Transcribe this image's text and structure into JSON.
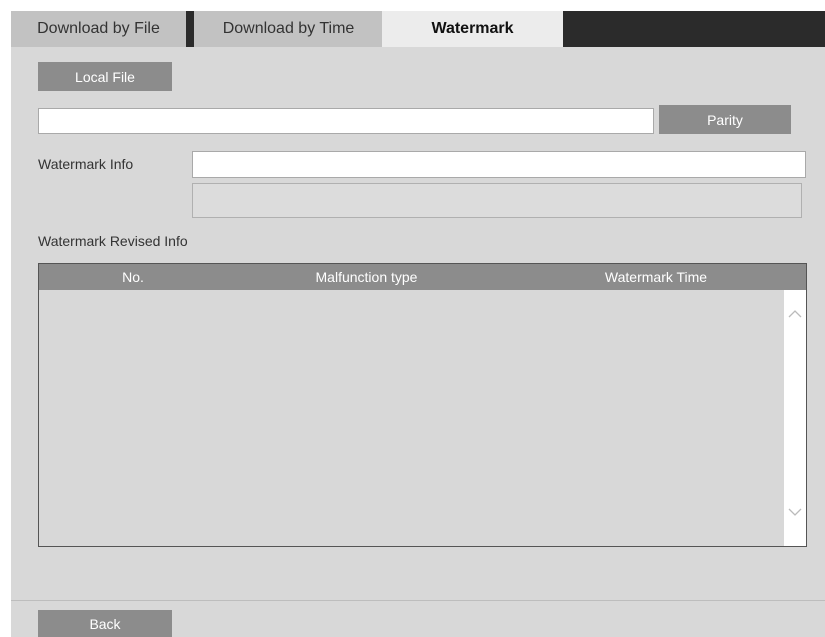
{
  "tabs": [
    {
      "label": "Download by File",
      "active": false
    },
    {
      "label": "Download by Time",
      "active": false
    },
    {
      "label": "Watermark",
      "active": true
    }
  ],
  "toolbar": {
    "local_file_label": "Local File",
    "parity_label": "Parity"
  },
  "file_path": {
    "value": "",
    "placeholder": ""
  },
  "watermark_info": {
    "label": "Watermark Info",
    "value": "",
    "detail_value": ""
  },
  "revised_info": {
    "label": "Watermark Revised Info",
    "columns": [
      "No.",
      "Malfunction type",
      "Watermark Time"
    ],
    "rows": []
  },
  "scrollbar": {
    "up_icon": "chevron-up-icon",
    "down_icon": "chevron-down-icon"
  },
  "footer": {
    "back_label": "Back"
  },
  "colors": {
    "tabbar_bg": "#2b2b2b",
    "active_tab_bg": "#ececec",
    "inactive_tab_bg": "#c2c2c2",
    "button_bg": "#8c8c8c",
    "panel_bg": "#d8d8d8"
  }
}
